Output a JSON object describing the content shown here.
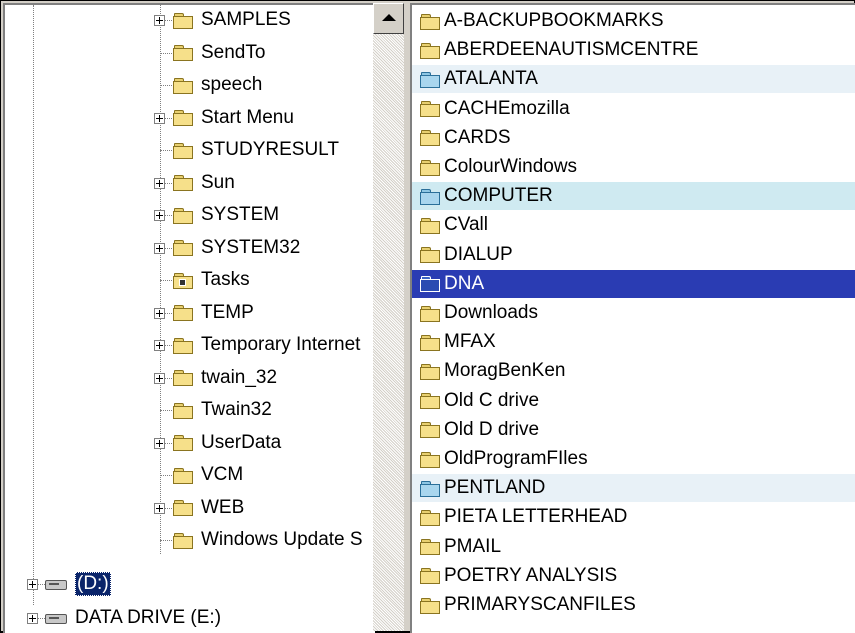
{
  "tree": {
    "items": [
      {
        "label": "SAMPLES",
        "expandable": true,
        "icon": "folder-icon"
      },
      {
        "label": "SendTo",
        "expandable": false,
        "icon": "folder-icon"
      },
      {
        "label": "speech",
        "expandable": false,
        "icon": "folder-icon"
      },
      {
        "label": "Start Menu",
        "expandable": true,
        "icon": "folder-icon"
      },
      {
        "label": "STUDYRESULT",
        "expandable": false,
        "icon": "folder-icon"
      },
      {
        "label": "Sun",
        "expandable": true,
        "icon": "folder-icon"
      },
      {
        "label": "SYSTEM",
        "expandable": true,
        "icon": "folder-icon"
      },
      {
        "label": "SYSTEM32",
        "expandable": true,
        "icon": "folder-icon"
      },
      {
        "label": "Tasks",
        "expandable": false,
        "icon": "scheduled-tasks-folder-icon"
      },
      {
        "label": "TEMP",
        "expandable": true,
        "icon": "folder-icon"
      },
      {
        "label": "Temporary Internet",
        "expandable": true,
        "icon": "folder-icon"
      },
      {
        "label": "twain_32",
        "expandable": true,
        "icon": "folder-icon"
      },
      {
        "label": "Twain32",
        "expandable": false,
        "icon": "folder-icon"
      },
      {
        "label": "UserData",
        "expandable": true,
        "icon": "folder-icon"
      },
      {
        "label": "VCM",
        "expandable": false,
        "icon": "folder-icon"
      },
      {
        "label": "WEB",
        "expandable": true,
        "icon": "folder-icon"
      },
      {
        "label": "Windows Update S",
        "expandable": false,
        "icon": "folder-icon"
      }
    ],
    "drives": [
      {
        "label": "(D:)",
        "selected": true,
        "icon": "drive-icon"
      },
      {
        "label": "DATA DRIVE (E:)",
        "selected": false,
        "icon": "drive-icon"
      }
    ]
  },
  "list": {
    "items": [
      {
        "label": "A-BACKUPBOOKMARKS",
        "state": "normal"
      },
      {
        "label": "ABERDEENAUTISMCENTRE",
        "state": "normal"
      },
      {
        "label": "ATALANTA",
        "state": "highlight"
      },
      {
        "label": "CACHEmozilla",
        "state": "normal"
      },
      {
        "label": "CARDS",
        "state": "normal"
      },
      {
        "label": "ColourWindows",
        "state": "normal"
      },
      {
        "label": "COMPUTER",
        "state": "highlight2"
      },
      {
        "label": "CVall",
        "state": "normal"
      },
      {
        "label": "DIALUP",
        "state": "normal"
      },
      {
        "label": "DNA",
        "state": "selected"
      },
      {
        "label": "Downloads",
        "state": "normal"
      },
      {
        "label": "MFAX",
        "state": "normal"
      },
      {
        "label": "MoragBenKen",
        "state": "normal"
      },
      {
        "label": "Old C drive",
        "state": "normal"
      },
      {
        "label": "Old D drive",
        "state": "normal"
      },
      {
        "label": "OldProgramFIles",
        "state": "normal"
      },
      {
        "label": "PENTLAND",
        "state": "highlight"
      },
      {
        "label": "PIETA LETTERHEAD",
        "state": "normal"
      },
      {
        "label": "PMAIL",
        "state": "normal"
      },
      {
        "label": "POETRY ANALYSIS",
        "state": "normal"
      },
      {
        "label": "PRIMARYSCANFILES",
        "state": "normal"
      }
    ]
  },
  "colors": {
    "selection": "#0a246a",
    "list_selection": "#2a3cb3",
    "folder_yellow": "#f6e08a",
    "folder_blue": "#a9d6ee",
    "window_face": "#d4d0c8"
  }
}
